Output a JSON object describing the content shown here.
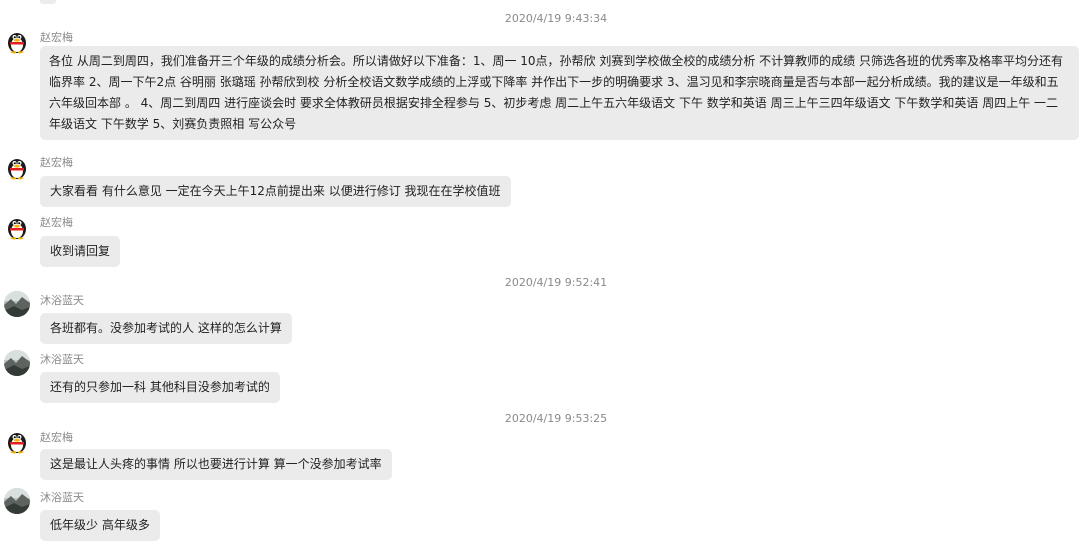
{
  "timestamps": [
    "2020/4/19 9:43:34",
    "2020/4/19 9:52:41",
    "2020/4/19 9:53:25"
  ],
  "messages": [
    {
      "sender": "赵宏梅",
      "avatar_icon": "qq-penguin-avatar-icon",
      "text": "各位 从周二到周四，我们准备开三个年级的成绩分析会。所以请做好以下准备：1、周一 10点，孙帮欣 刘赛到学校做全校的成绩分析 不计算教师的成绩 只筛选各班的优秀率及格率平均分还有临界率 2、周一下午2点 谷明丽 张璐瑶 孙帮欣到校 分析全校语文数学成绩的上浮或下降率 并作出下一步的明确要求 3、温习见和李宗晓商量是否与本部一起分析成绩。我的建议是一年级和五六年级回本部 。 4、周二到周四 进行座谈会时 要求全体教研员根据安排全程参与 5、初步考虑 周二上午五六年级语文 下午 数学和英语 周三上午三四年级语文 下午数学和英语 周四上午 一二年级语文 下午数学 5、刘赛负责照相 写公众号"
    },
    {
      "sender": "赵宏梅",
      "avatar_icon": "qq-penguin-avatar-icon",
      "text": "大家看看 有什么意见 一定在今天上午12点前提出来 以便进行修订 我现在在学校值班"
    },
    {
      "sender": "赵宏梅",
      "avatar_icon": "qq-penguin-avatar-icon",
      "text": "收到请回复"
    },
    {
      "sender": "沐浴蓝天",
      "avatar_icon": "landscape-photo-avatar-icon",
      "text": "各班都有。没参加考试的人 这样的怎么计算"
    },
    {
      "sender": "沐浴蓝天",
      "avatar_icon": "landscape-photo-avatar-icon",
      "text": "还有的只参加一科 其他科目没参加考试的"
    },
    {
      "sender": "赵宏梅",
      "avatar_icon": "qq-penguin-avatar-icon",
      "text": "这是最让人头疼的事情 所以也要进行计算 算一个没参加考试率"
    },
    {
      "sender": "沐浴蓝天",
      "avatar_icon": "landscape-photo-avatar-icon",
      "text": "低年级少 高年级多"
    }
  ],
  "colors": {
    "bubble_bg": "#ebebeb",
    "meta_text": "#8a8a8a",
    "page_bg": "#ffffff"
  }
}
